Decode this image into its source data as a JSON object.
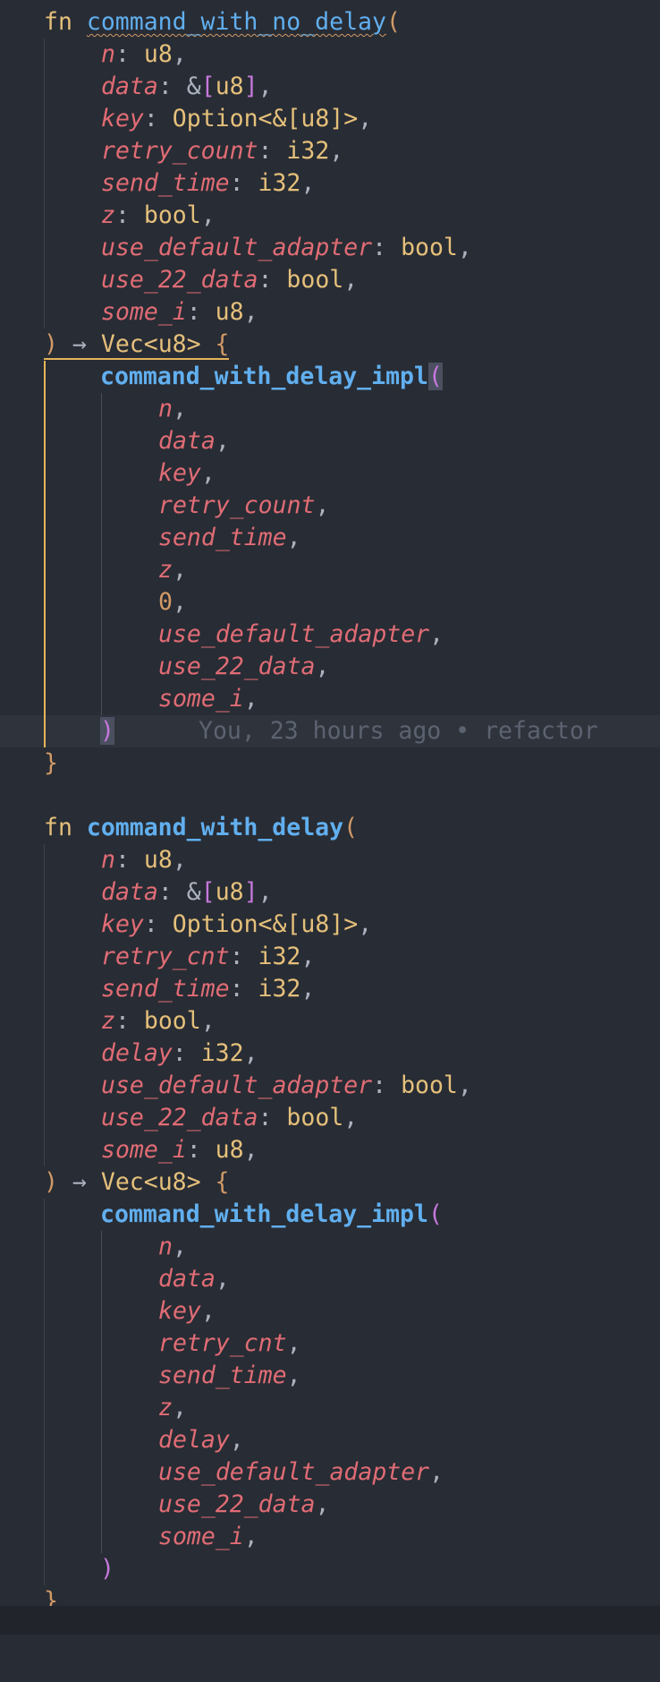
{
  "editor": {
    "language": "rust",
    "colors": {
      "background": "#282c34",
      "keyword": "#e5c07b",
      "function": "#61afef",
      "parameter": "#e06c75",
      "type": "#e5c07b",
      "bracket": "#c678dd",
      "scope_guide": "#e5b45a",
      "blame": "#5c6370"
    },
    "fn1": {
      "keyword": "fn",
      "name": "command_with_no_delay",
      "open_paren": "(",
      "params": [
        {
          "name": "n",
          "type": "u8"
        },
        {
          "name": "data",
          "type_prefix": "&",
          "type_open": "[",
          "type_inner": "u8",
          "type_close": "]"
        },
        {
          "name": "key",
          "type": "Option<&[u8]>"
        },
        {
          "name": "retry_count",
          "type": "i32"
        },
        {
          "name": "send_time",
          "type": "i32"
        },
        {
          "name": "z",
          "type": "bool"
        },
        {
          "name": "use_default_adapter",
          "type": "bool"
        },
        {
          "name": "use_22_data",
          "type": "bool"
        },
        {
          "name": "some_i",
          "type": "u8"
        }
      ],
      "close_paren": ")",
      "arrow": "→",
      "return_type": "Vec<u8>",
      "open_brace": "{",
      "call": "command_with_delay_impl",
      "args": [
        "n",
        "data",
        "key",
        "retry_count",
        "send_time",
        "z",
        "0",
        "use_default_adapter",
        "use_22_data",
        "some_i"
      ],
      "close_brace": "}"
    },
    "blame": "You, 23 hours ago • refactor",
    "fn2": {
      "keyword": "fn",
      "name": "command_with_delay",
      "open_paren": "(",
      "params": [
        {
          "name": "n",
          "type": "u8"
        },
        {
          "name": "data",
          "type_prefix": "&",
          "type_open": "[",
          "type_inner": "u8",
          "type_close": "]"
        },
        {
          "name": "key",
          "type": "Option<&[u8]>"
        },
        {
          "name": "retry_cnt",
          "type": "i32"
        },
        {
          "name": "send_time",
          "type": "i32"
        },
        {
          "name": "z",
          "type": "bool"
        },
        {
          "name": "delay",
          "type": "i32"
        },
        {
          "name": "use_default_adapter",
          "type": "bool"
        },
        {
          "name": "use_22_data",
          "type": "bool"
        },
        {
          "name": "some_i",
          "type": "u8"
        }
      ],
      "close_paren": ")",
      "arrow": "→",
      "return_type": "Vec<u8>",
      "open_brace": "{",
      "call": "command_with_delay_impl",
      "args": [
        "n",
        "data",
        "key",
        "retry_cnt",
        "send_time",
        "z",
        "delay",
        "use_default_adapter",
        "use_22_data",
        "some_i"
      ],
      "close_brace": "}"
    }
  }
}
